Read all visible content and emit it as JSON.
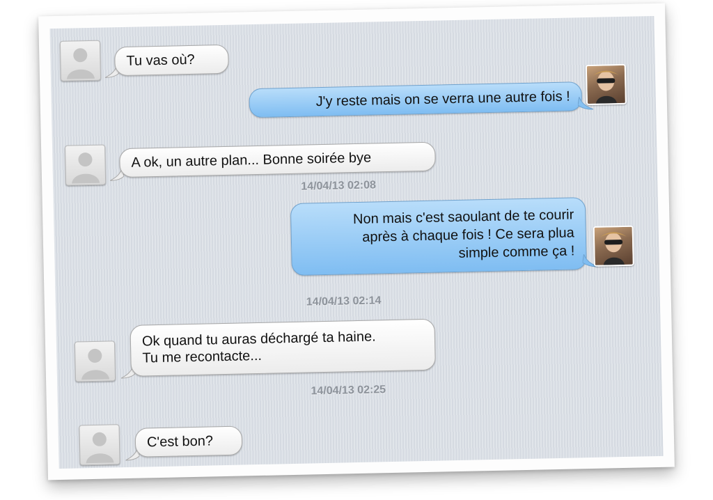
{
  "conversation": {
    "messages": [
      {
        "direction": "incoming",
        "text": "Tu vas où?"
      },
      {
        "direction": "outgoing",
        "text": "J'y reste mais on se verra une autre fois !"
      },
      {
        "direction": "incoming",
        "text": "A ok, un autre plan... Bonne soirée bye"
      },
      {
        "direction": "outgoing",
        "lines": [
          "Non mais c'est saoulant de te courir",
          "après à chaque fois ! Ce sera plua",
          "simple comme ça !"
        ]
      },
      {
        "direction": "incoming",
        "lines": [
          "Ok quand tu auras déchargé ta haine.",
          "Tu me recontacte..."
        ]
      },
      {
        "direction": "incoming",
        "text": "C'est bon?"
      }
    ],
    "timestamps": [
      "14/04/13 02:08",
      "14/04/13 02:14",
      "14/04/13 02:25"
    ],
    "avatars": {
      "contact": "default-person-icon",
      "self": "user-photo-avatar"
    }
  },
  "colors": {
    "background": "#dadfe6",
    "incoming_bubble": "#f3f3f3",
    "outgoing_bubble": "#8cc6f4",
    "timestamp": "#8d939b"
  }
}
